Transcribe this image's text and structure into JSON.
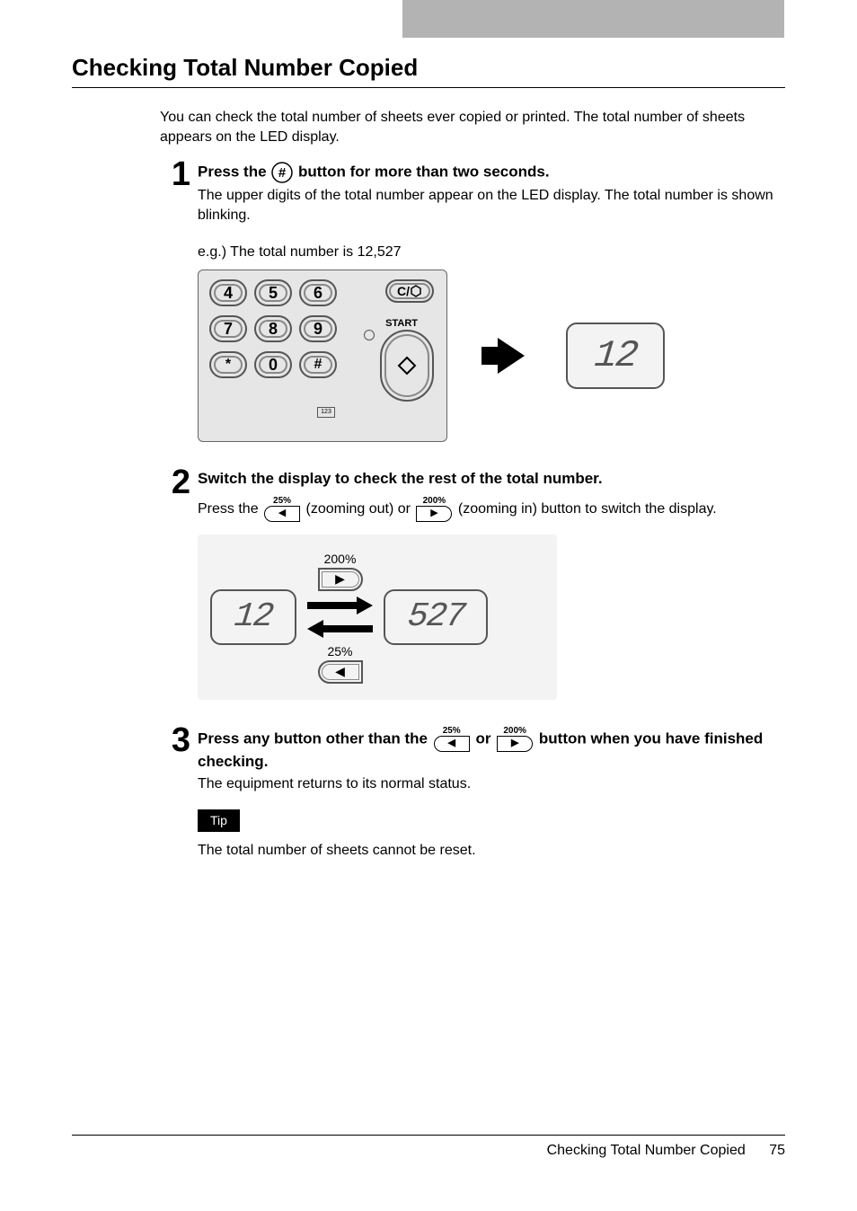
{
  "page": {
    "title": "Checking Total Number Copied",
    "intro": "You can check the total number of sheets ever copied or printed. The total number of sheets appears on the LED display.",
    "footer_title": "Checking Total Number Copied",
    "page_number": "75"
  },
  "step1": {
    "title_before": "Press the ",
    "title_after": " button for more than two seconds.",
    "desc": "The upper digits of the total number appear on the LED display. The total number is shown blinking.",
    "example_label": "e.g.) The total number is 12,527",
    "display_value": "12",
    "keys": {
      "row1": [
        "4",
        "5",
        "6"
      ],
      "row2": [
        "7",
        "8",
        "9"
      ],
      "row3": [
        "*",
        "0",
        "#"
      ],
      "clear": "C/",
      "start": "START",
      "counter_label": "123"
    }
  },
  "step2": {
    "title": "Switch the display to check the rest of the total number.",
    "desc_before": "Press the ",
    "desc_mid": " (zooming out) or ",
    "desc_after": " (zooming in) button to switch the display.",
    "zoom_out_pct": "25%",
    "zoom_in_pct": "200%",
    "display_left": "12",
    "display_right": "527"
  },
  "step3": {
    "title_before": "Press any button other than the ",
    "title_mid": " or ",
    "title_after": " button when you have finished checking.",
    "desc": "The equipment returns to its normal status.",
    "tip_label": "Tip",
    "tip_text": "The total number of sheets cannot be reset."
  }
}
